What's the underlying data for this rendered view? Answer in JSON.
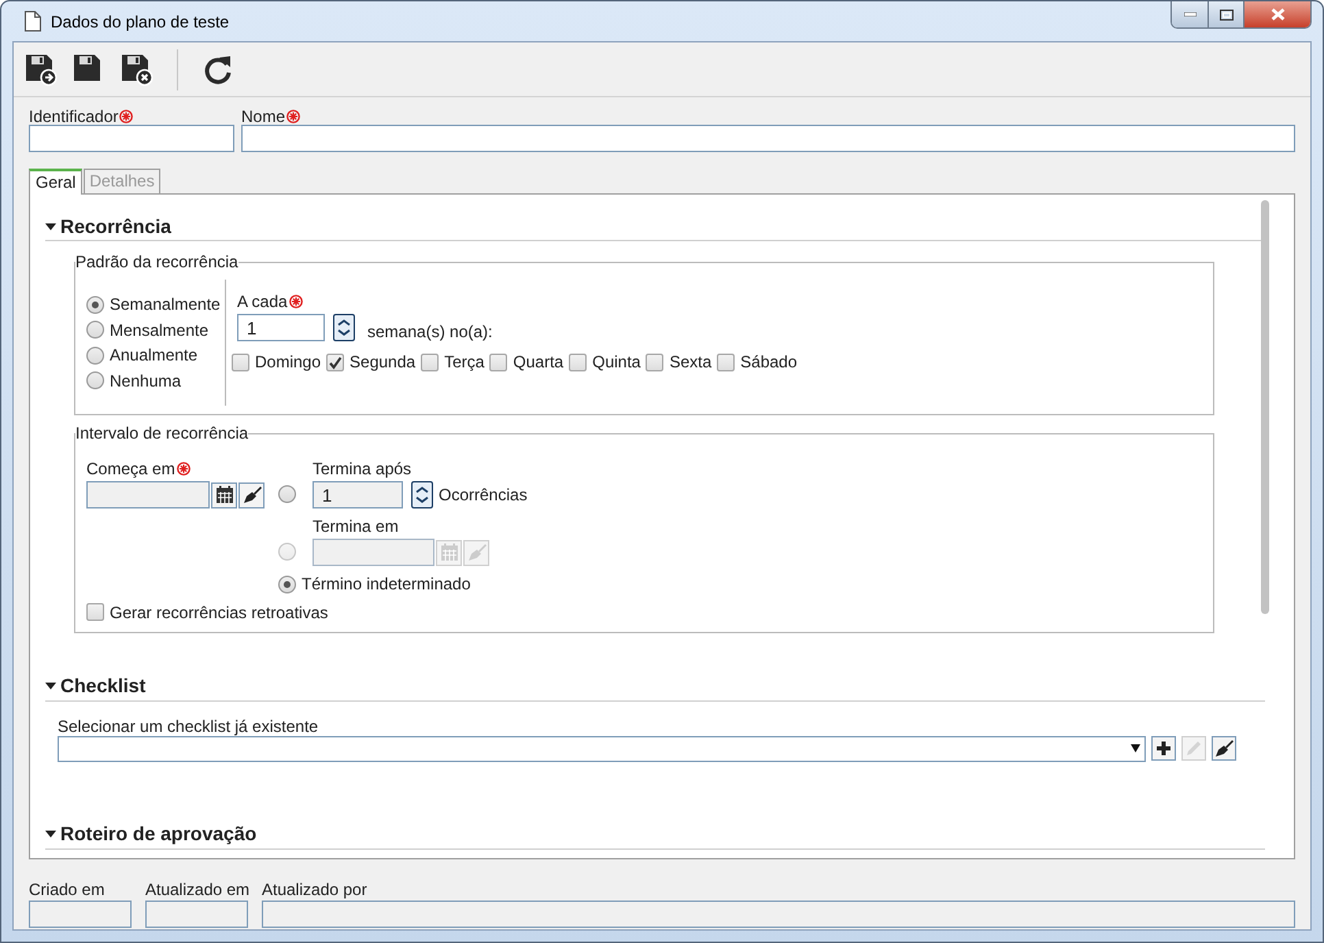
{
  "window": {
    "title": "Dados do plano de teste"
  },
  "toolbar": [
    {
      "kind": "save-new"
    },
    {
      "kind": "save"
    },
    {
      "kind": "save-close"
    },
    {
      "kind": "separator"
    },
    {
      "kind": "refresh"
    }
  ],
  "fields": [
    {
      "label": "Identificador",
      "required": true
    },
    {
      "label": "Nome",
      "required": true
    }
  ],
  "tabs": [
    {
      "label": "Geral",
      "selected": true
    },
    {
      "label": "Detalhes",
      "selected": false
    }
  ],
  "recurrence": {
    "title": "Recorrência",
    "expanded": true,
    "pattern": {
      "legend": "Padrão da recorrência",
      "options": [
        {
          "label": "Semanalmente",
          "selected": true
        },
        {
          "label": "Mensalmente",
          "selected": false
        },
        {
          "label": "Anualmente",
          "selected": false
        },
        {
          "label": "Nenhuma",
          "selected": false
        }
      ],
      "every_label": "A cada",
      "every_required": true,
      "every_value": "1",
      "every_unit": "semana(s) no(a):",
      "days": [
        {
          "label": "Domingo",
          "checked": false
        },
        {
          "label": "Segunda",
          "checked": true
        },
        {
          "label": "Terça",
          "checked": false
        },
        {
          "label": "Quarta",
          "checked": false
        },
        {
          "label": "Quinta",
          "checked": false
        },
        {
          "label": "Sexta",
          "checked": false
        },
        {
          "label": "Sábado",
          "checked": false
        }
      ]
    },
    "interval": {
      "legend": "Intervalo de recorrência",
      "start_label": "Começa em",
      "start_required": true,
      "end_options": [
        {
          "kind": "count",
          "label": "Termina após",
          "value": "1",
          "unit": "Ocorrências",
          "selected": false,
          "disabled": false
        },
        {
          "kind": "date",
          "label": "Termina em",
          "selected": false,
          "disabled": true
        },
        {
          "kind": "none",
          "label": "Término indeterminado",
          "selected": true,
          "disabled": false
        }
      ],
      "retroactive": {
        "label": "Gerar recorrências retroativas",
        "checked": false
      }
    }
  },
  "checklist": {
    "title": "Checklist",
    "expanded": true,
    "label": "Selecionar um checklist já existente",
    "edit_disabled": true
  },
  "approval": {
    "title": "Roteiro de aprovação",
    "expanded": true
  },
  "footer": [
    {
      "label": "Criado em"
    },
    {
      "label": "Atualizado em"
    },
    {
      "label": "Atualizado por"
    }
  ]
}
